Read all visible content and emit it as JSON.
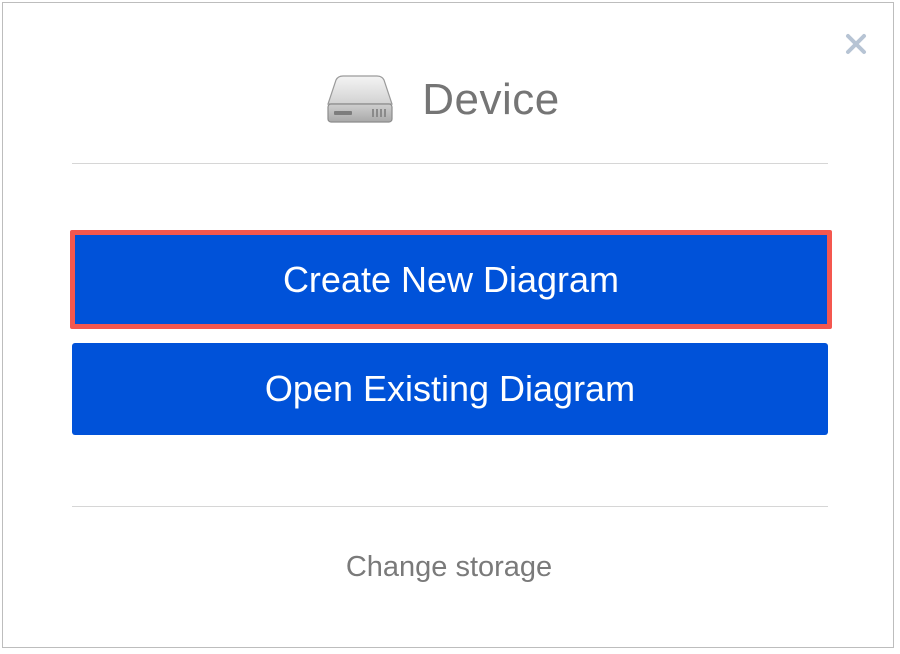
{
  "dialog": {
    "title": "Device",
    "header_icon": "hard-drive-icon",
    "close_icon": "close-icon"
  },
  "buttons": {
    "create_label": "Create New Diagram",
    "open_label": "Open Existing Diagram"
  },
  "footer": {
    "change_storage_label": "Change storage"
  },
  "colors": {
    "primary_button": "#0052d9",
    "highlight_border": "#f4574f",
    "title_text": "#757575",
    "link_text": "#7a7a7a"
  }
}
